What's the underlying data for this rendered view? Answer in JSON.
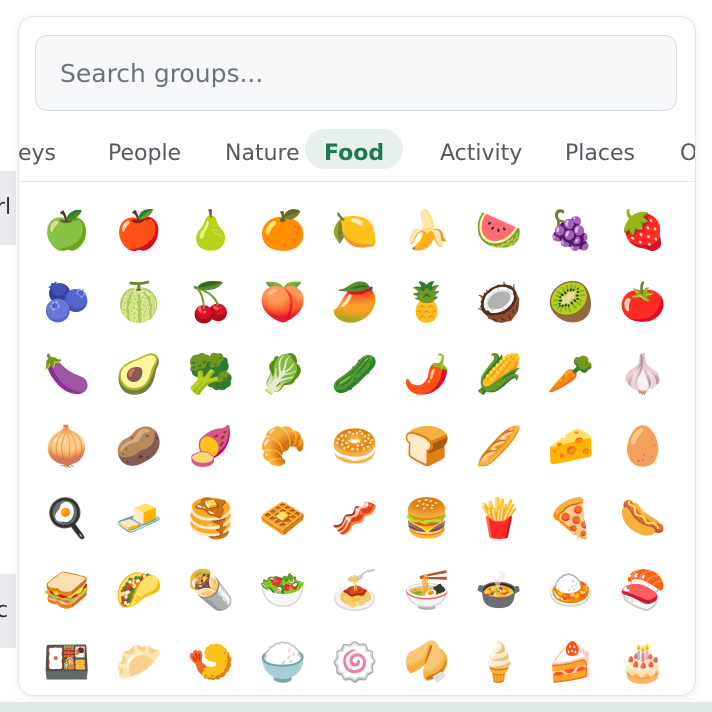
{
  "background": {
    "top_fragment": "rl",
    "bottom_fragment": "c 🥄"
  },
  "search": {
    "placeholder": "Search groups..."
  },
  "tabs": [
    {
      "label": "eys",
      "active": false
    },
    {
      "label": "People",
      "active": false
    },
    {
      "label": "Nature",
      "active": false
    },
    {
      "label": "Food",
      "active": true
    },
    {
      "label": "Activity",
      "active": false
    },
    {
      "label": "Places",
      "active": false
    },
    {
      "label": "Obj",
      "active": false
    }
  ],
  "accent_color": "#1f7a52",
  "emoji_rows": [
    [
      "🍏",
      "🍎",
      "🍐",
      "🍊",
      "🍋",
      "🍌",
      "🍉",
      "🍇",
      "🍓"
    ],
    [
      "🫐",
      "🍈",
      "🍒",
      "🍑",
      "🥭",
      "🍍",
      "🥥",
      "🥝",
      "🍅"
    ],
    [
      "🍆",
      "🥑",
      "🥦",
      "🥬",
      "🥒",
      "🌶️",
      "🌽",
      "🥕",
      "🧄"
    ],
    [
      "🧅",
      "🥔",
      "🍠",
      "🥐",
      "🥯",
      "🍞",
      "🥖",
      "🧀",
      "🥚"
    ],
    [
      "🍳",
      "🧈",
      "🥞",
      "🧇",
      "🥓",
      "🍔",
      "🍟",
      "🍕",
      "🌭"
    ],
    [
      "🥪",
      "🌮",
      "🌯",
      "🥗",
      "🍝",
      "🍜",
      "🍲",
      "🍛",
      "🍣"
    ],
    [
      "🍱",
      "🥟",
      "🍤",
      "🍚",
      "🍥",
      "🥠",
      "🍦",
      "🍰",
      "🎂"
    ]
  ]
}
